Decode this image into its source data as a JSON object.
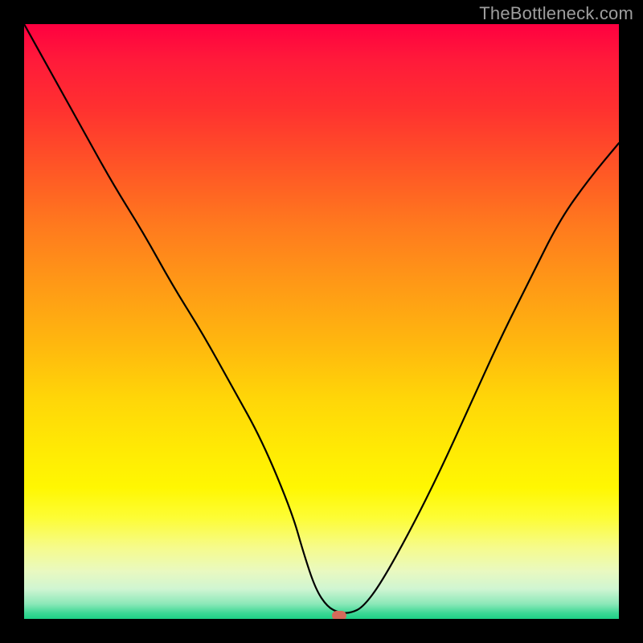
{
  "watermark": "TheBottleneck.com",
  "chart_data": {
    "type": "line",
    "title": "",
    "xlabel": "",
    "ylabel": "",
    "xlim": [
      0,
      100
    ],
    "ylim": [
      0,
      100
    ],
    "grid": false,
    "x": [
      0,
      5,
      10,
      15,
      20,
      25,
      30,
      35,
      40,
      45,
      47,
      49,
      51,
      53,
      55,
      57,
      60,
      65,
      70,
      75,
      80,
      85,
      90,
      95,
      100
    ],
    "values": [
      100,
      91,
      82,
      73,
      65,
      56,
      48,
      39,
      30,
      18,
      11,
      5,
      2,
      1,
      1,
      2,
      6,
      15,
      25,
      36,
      47,
      57,
      67,
      74,
      80
    ],
    "marker": {
      "x": 53,
      "y": 0.5,
      "color": "#d46a5a"
    }
  }
}
